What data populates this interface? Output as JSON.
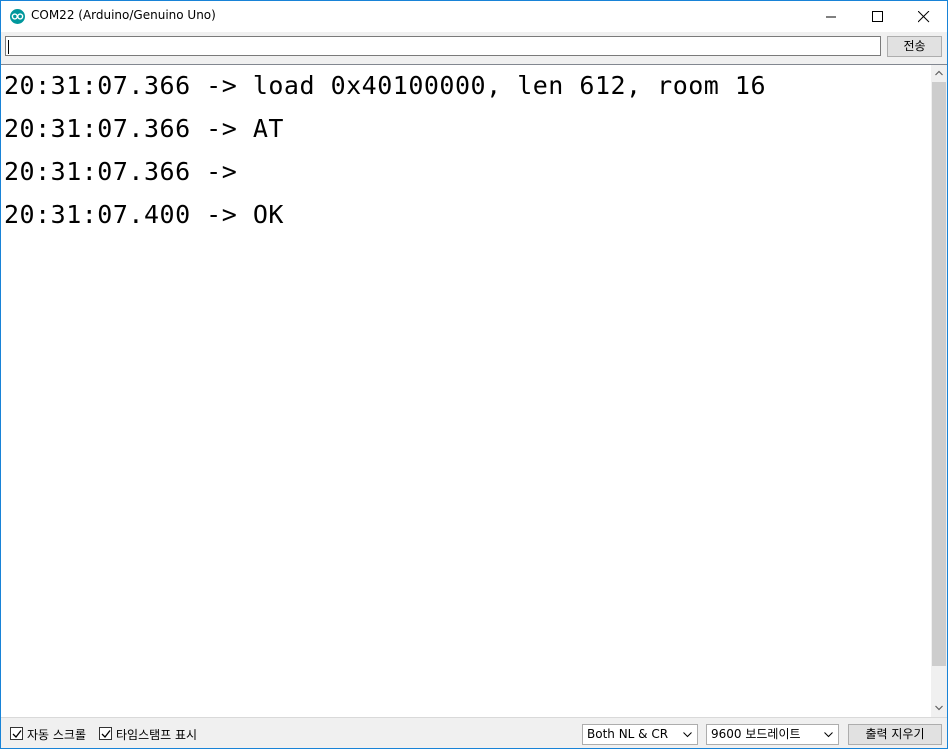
{
  "window": {
    "title": "COM22 (Arduino/Genuino Uno)",
    "accent_color": "#1883d7",
    "icon": "arduino-icon"
  },
  "input": {
    "value": "",
    "send_label": "전송"
  },
  "output_lines": [
    "20:31:07.366 -> load 0x40100000, len 612, room 16",
    "20:31:07.366 -> AT",
    "20:31:07.366 -> ",
    "20:31:07.400 -> OK"
  ],
  "footer": {
    "autoscroll_label": "자동 스크롤",
    "autoscroll_checked": true,
    "timestamp_label": "타임스탬프 표시",
    "timestamp_checked": true,
    "line_ending_selected": "Both NL & CR",
    "baud_selected": "9600 보드레이트",
    "clear_label": "출력 지우기"
  }
}
